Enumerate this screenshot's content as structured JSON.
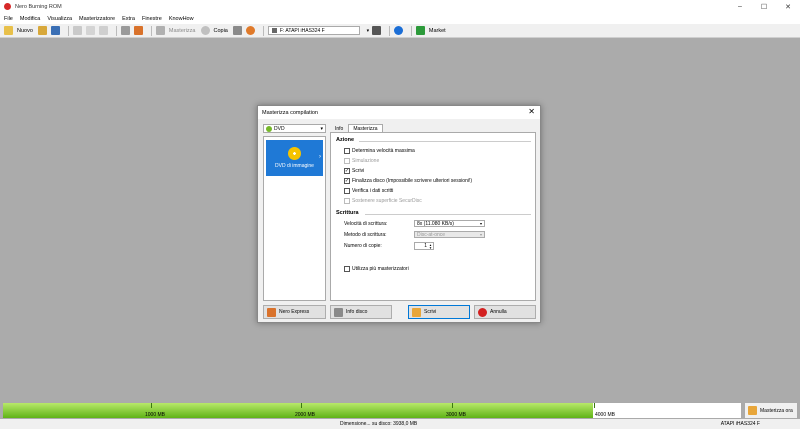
{
  "window": {
    "title": "Nero Burning ROM"
  },
  "window_controls": {
    "minimize": "–",
    "maximize": "☐",
    "close": "✕"
  },
  "menu": [
    "File",
    "Modifica",
    "Visualizza",
    "Masterizzatore",
    "Extra",
    "Finestre",
    "KnowHow"
  ],
  "toolbar": {
    "new_label": "Nuovo",
    "burn_label": "Masterizza",
    "copy_label": "Copia",
    "drive": "F: ATAPI iHAS324  F",
    "drive_arrow": "▾",
    "market_label": "Market",
    "colors": {
      "new": "#e8c04a",
      "save": "#3a6fb5",
      "burn": "#d9722b",
      "info": "#1b6ed6",
      "market": "#2c9a3a"
    }
  },
  "dialog": {
    "title": "Masterizza compilation",
    "close": "✕",
    "compilation_type": "DVD",
    "combo_arrow": "▾",
    "compilation_item": "DVD di immagine",
    "chevron": "›",
    "tabs": [
      "Info",
      "Masterizza"
    ],
    "actions_title": "Azione",
    "options": [
      {
        "label": "Determina velocità massima",
        "checked": false,
        "enabled": true
      },
      {
        "label": "Simulazione",
        "checked": false,
        "enabled": false
      },
      {
        "label": "Scrivi",
        "checked": true,
        "enabled": true
      },
      {
        "label": "Finalizza disco (Impossibile scrivere ulteriori sessioni!)",
        "checked": true,
        "enabled": true
      },
      {
        "label": "Verifica i dati scritti",
        "checked": false,
        "enabled": true
      },
      {
        "label": "Sostenere superficie SecurDisc",
        "checked": false,
        "enabled": false
      }
    ],
    "writing_title": "Scrittura",
    "write_speed_label": "Velocità di scrittura:",
    "write_speed_value": "8x (11.080 KB/s)",
    "write_method_label": "Metodo di scrittura:",
    "write_method_value": "Disc-at-once",
    "copies_label": "Numero di copie:",
    "copies_value": "1",
    "spin_up": "▲",
    "spin_down": "▼",
    "multi_burn_label": "Utilizza più masterizzatori",
    "multi_burn_checked": false,
    "buttons": {
      "express": "Nero Express",
      "disc_info": "Info disco",
      "burn": "Scrivi",
      "cancel": "Annulla"
    },
    "colors": {
      "accent": "#1f79d6",
      "cancel": "#d32020"
    }
  },
  "capacity": {
    "used_fraction": 0.8,
    "marks": [
      "1000 MB",
      "2000 MB",
      "3000 MB",
      "4000 MB"
    ],
    "burn_now": "Masterizza ora"
  },
  "status": {
    "center": "Dimensione... su disco: 3938,0 MB",
    "drive": "ATAPI  iHAS324  F"
  }
}
